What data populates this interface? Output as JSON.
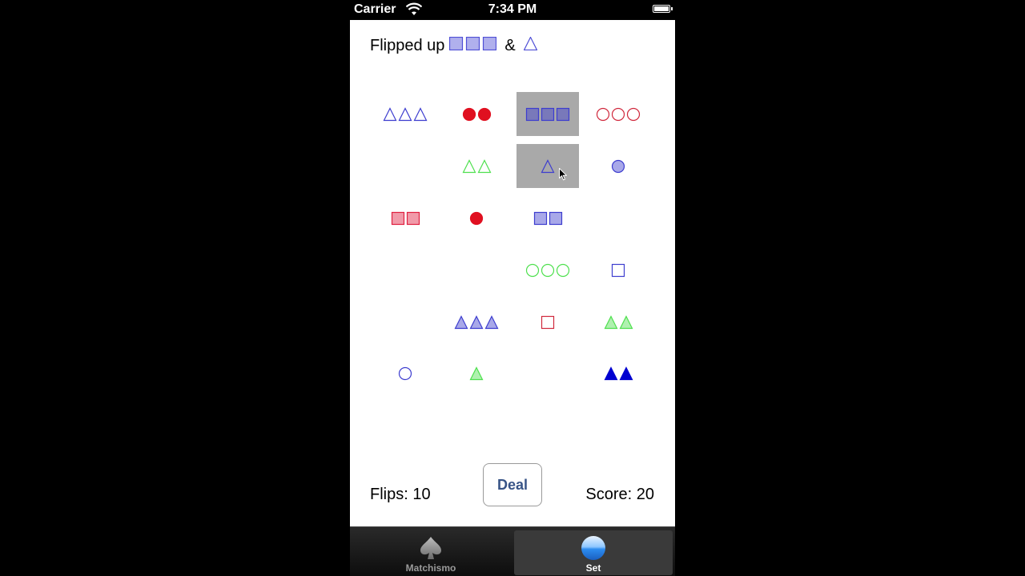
{
  "status_bar": {
    "carrier": "Carrier",
    "time": "7:34 PM"
  },
  "header": {
    "flipped_prefix": "Flipped up",
    "separator": "&",
    "flipped_cards": [
      {
        "shape": "square",
        "count": 3,
        "color": "#4f4fd6",
        "fill": "shaded"
      },
      {
        "shape": "triangle",
        "count": 1,
        "color": "#4f4fd6",
        "fill": "open"
      }
    ]
  },
  "cards": [
    {
      "row": 0,
      "col": 0,
      "shape": "triangle",
      "count": 3,
      "color": "#3d3dcf",
      "fill": "open",
      "selected": false
    },
    {
      "row": 0,
      "col": 1,
      "shape": "circle",
      "count": 2,
      "color": "#e01020",
      "fill": "solid",
      "selected": false
    },
    {
      "row": 0,
      "col": 2,
      "shape": "square",
      "count": 3,
      "color": "#3d3dcf",
      "fill": "shaded",
      "selected": true
    },
    {
      "row": 0,
      "col": 3,
      "shape": "circle",
      "count": 3,
      "color": "#d0283c",
      "fill": "open",
      "selected": false
    },
    {
      "row": 1,
      "col": 1,
      "shape": "triangle",
      "count": 2,
      "color": "#4ee04e",
      "fill": "open",
      "selected": false
    },
    {
      "row": 1,
      "col": 2,
      "shape": "triangle",
      "count": 1,
      "color": "#3d3dcf",
      "fill": "open",
      "selected": true
    },
    {
      "row": 1,
      "col": 3,
      "shape": "circle",
      "count": 1,
      "color": "#3d3dcf",
      "fill": "shaded",
      "selected": false
    },
    {
      "row": 2,
      "col": 0,
      "shape": "square",
      "count": 2,
      "color": "#e02040",
      "fill": "shaded",
      "selected": false
    },
    {
      "row": 2,
      "col": 1,
      "shape": "circle",
      "count": 1,
      "color": "#e01020",
      "fill": "solid",
      "selected": false
    },
    {
      "row": 2,
      "col": 2,
      "shape": "square",
      "count": 2,
      "color": "#3d3dcf",
      "fill": "shaded",
      "selected": false
    },
    {
      "row": 3,
      "col": 2,
      "shape": "circle",
      "count": 3,
      "color": "#4ee04e",
      "fill": "open",
      "selected": false
    },
    {
      "row": 3,
      "col": 3,
      "shape": "square",
      "count": 1,
      "color": "#3d3dcf",
      "fill": "open",
      "selected": false
    },
    {
      "row": 4,
      "col": 1,
      "shape": "triangle",
      "count": 3,
      "color": "#3d3dcf",
      "fill": "shaded",
      "selected": false
    },
    {
      "row": 4,
      "col": 2,
      "shape": "square",
      "count": 1,
      "color": "#d0283c",
      "fill": "open",
      "selected": false
    },
    {
      "row": 4,
      "col": 3,
      "shape": "triangle",
      "count": 2,
      "color": "#4ee04e",
      "fill": "shaded",
      "selected": false
    },
    {
      "row": 5,
      "col": 0,
      "shape": "circle",
      "count": 1,
      "color": "#3d3dcf",
      "fill": "open",
      "selected": false
    },
    {
      "row": 5,
      "col": 1,
      "shape": "triangle",
      "count": 1,
      "color": "#4ee04e",
      "fill": "shaded",
      "selected": false
    },
    {
      "row": 5,
      "col": 3,
      "shape": "triangle",
      "count": 2,
      "color": "#0000d0",
      "fill": "solid",
      "selected": false
    }
  ],
  "footer": {
    "flips": "Flips: 10",
    "deal_label": "Deal",
    "score": "Score: 20"
  },
  "tabs": [
    {
      "label": "Matchismo",
      "icon": "spade-icon",
      "active": false
    },
    {
      "label": "Set",
      "icon": "set-icon",
      "active": true
    }
  ]
}
